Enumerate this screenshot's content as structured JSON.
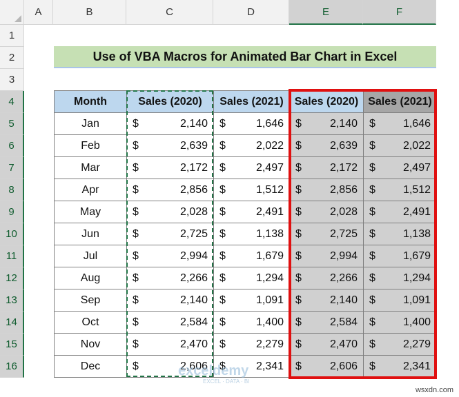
{
  "columns": [
    "A",
    "B",
    "C",
    "D",
    "E",
    "F"
  ],
  "rows": [
    "1",
    "2",
    "3",
    "4",
    "5",
    "6",
    "7",
    "8",
    "9",
    "10",
    "11",
    "12",
    "13",
    "14",
    "15",
    "16"
  ],
  "title": "Use of  VBA Macros for Animated Bar Chart in Excel",
  "table": {
    "headers": [
      "Month",
      "Sales (2020)",
      "Sales (2021)",
      "Sales (2020)",
      "Sales (2021)"
    ],
    "currency": "$",
    "rows": [
      {
        "month": "Jan",
        "s2020": "2,140",
        "s2021": "1,646"
      },
      {
        "month": "Feb",
        "s2020": "2,639",
        "s2021": "2,022"
      },
      {
        "month": "Mar",
        "s2020": "2,172",
        "s2021": "2,497"
      },
      {
        "month": "Apr",
        "s2020": "2,856",
        "s2021": "1,512"
      },
      {
        "month": "May",
        "s2020": "2,028",
        "s2021": "2,491"
      },
      {
        "month": "Jun",
        "s2020": "2,725",
        "s2021": "1,138"
      },
      {
        "month": "Jul",
        "s2020": "2,994",
        "s2021": "1,679"
      },
      {
        "month": "Aug",
        "s2020": "2,266",
        "s2021": "1,294"
      },
      {
        "month": "Sep",
        "s2020": "2,140",
        "s2021": "1,091"
      },
      {
        "month": "Oct",
        "s2020": "2,584",
        "s2021": "1,400"
      },
      {
        "month": "Nov",
        "s2020": "2,470",
        "s2021": "2,279"
      },
      {
        "month": "Dec",
        "s2020": "2,606",
        "s2021": "2,341"
      }
    ]
  },
  "watermark": {
    "name": "exceldemy",
    "tagline": "EXCEL · DATA · BI"
  },
  "credit": "wsxdn.com",
  "colors": {
    "accent": "#217346",
    "highlight": "#e01010",
    "header_fill": "#bdd7ee",
    "title_fill": "#c6e0b4"
  }
}
